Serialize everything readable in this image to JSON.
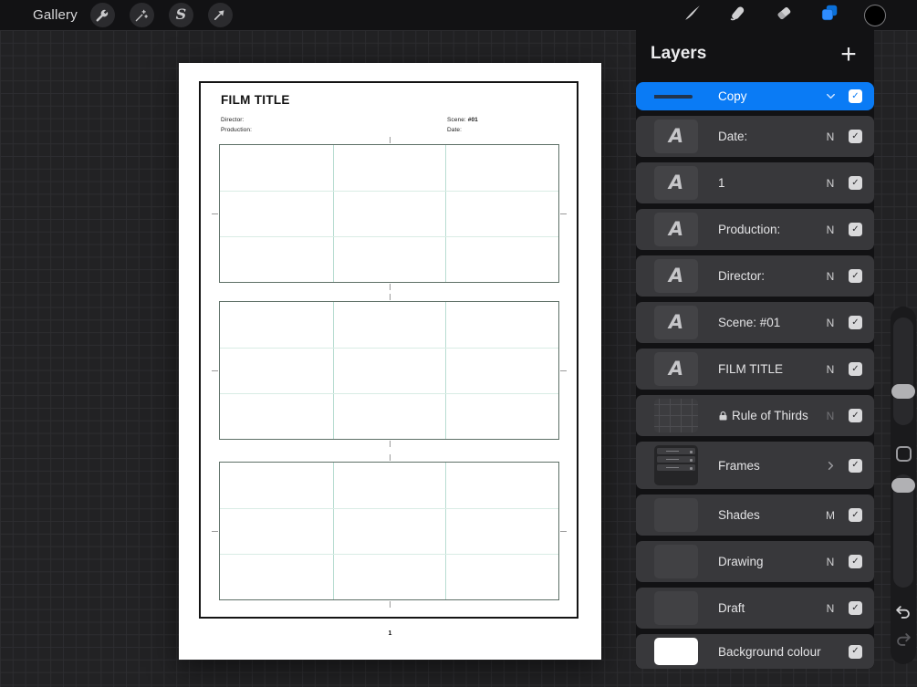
{
  "toolbar": {
    "gallery_label": "Gallery",
    "left_tools": [
      {
        "icon": "wrench-icon",
        "name": "actions"
      },
      {
        "icon": "magic-wand-icon",
        "name": "adjustments"
      },
      {
        "icon": "selection-s-icon",
        "name": "selection",
        "glyph": "S"
      },
      {
        "icon": "transform-arrow-icon",
        "name": "transform"
      }
    ],
    "right_tools": [
      {
        "icon": "brush-icon",
        "name": "brush"
      },
      {
        "icon": "smudge-icon",
        "name": "smudge"
      },
      {
        "icon": "eraser-icon",
        "name": "eraser"
      },
      {
        "icon": "layers-icon",
        "name": "layers",
        "active": true
      },
      {
        "icon": "color-swatch-icon",
        "name": "color",
        "color": "#000000"
      }
    ]
  },
  "layers_panel": {
    "title": "Layers",
    "add_button": "+",
    "rows": [
      {
        "label": "Copy",
        "selected": true,
        "thumb": "line",
        "control": "chevron-down",
        "checked": true
      },
      {
        "label": "Date:",
        "blend": "N",
        "thumb": "text",
        "checked": true
      },
      {
        "label": "1",
        "blend": "N",
        "thumb": "text",
        "checked": true
      },
      {
        "label": "Production:",
        "blend": "N",
        "thumb": "text",
        "checked": true
      },
      {
        "label": "Director:",
        "blend": "N",
        "thumb": "text",
        "checked": true
      },
      {
        "label": "Scene: #01",
        "blend": "N",
        "thumb": "text",
        "checked": true
      },
      {
        "label": "FILM TITLE",
        "blend": "N",
        "thumb": "text",
        "checked": true
      },
      {
        "label": "Rule of Thirds",
        "blend": "N",
        "blend_dimmed": true,
        "locked": true,
        "thumb": "grid",
        "checked": true
      },
      {
        "label": "Frames",
        "thumb": "group",
        "control": "chevron-right",
        "checked": true
      },
      {
        "label": "Shades",
        "blend": "M",
        "thumb": "solid",
        "checked": true
      },
      {
        "label": "Drawing",
        "blend": "N",
        "thumb": "solid",
        "checked": true
      },
      {
        "label": "Draft",
        "blend": "N",
        "thumb": "solid",
        "checked": true
      },
      {
        "label": "Background colour",
        "thumb": "white",
        "checked": true
      }
    ]
  },
  "canvas": {
    "film_title": "FILM TITLE",
    "director_label": "Director:",
    "production_label": "Production:",
    "scene_label": "Scene: ",
    "scene_value": "#01",
    "date_label": "Date:",
    "page_number": "1",
    "storyboard_blocks": 3,
    "frames_per_block": 3
  },
  "sidebar": {
    "sliders": [
      "brush-size-slider",
      "opacity-slider"
    ],
    "modify_button": "modify-button",
    "undo": "undo-button",
    "redo": "redo-button"
  },
  "colors": {
    "accent_blue": "#0a7bf5",
    "board_border": "#5d6f66",
    "board_line_vertical": "#b9ddd2",
    "board_line_horizontal": "#d9ece5"
  }
}
